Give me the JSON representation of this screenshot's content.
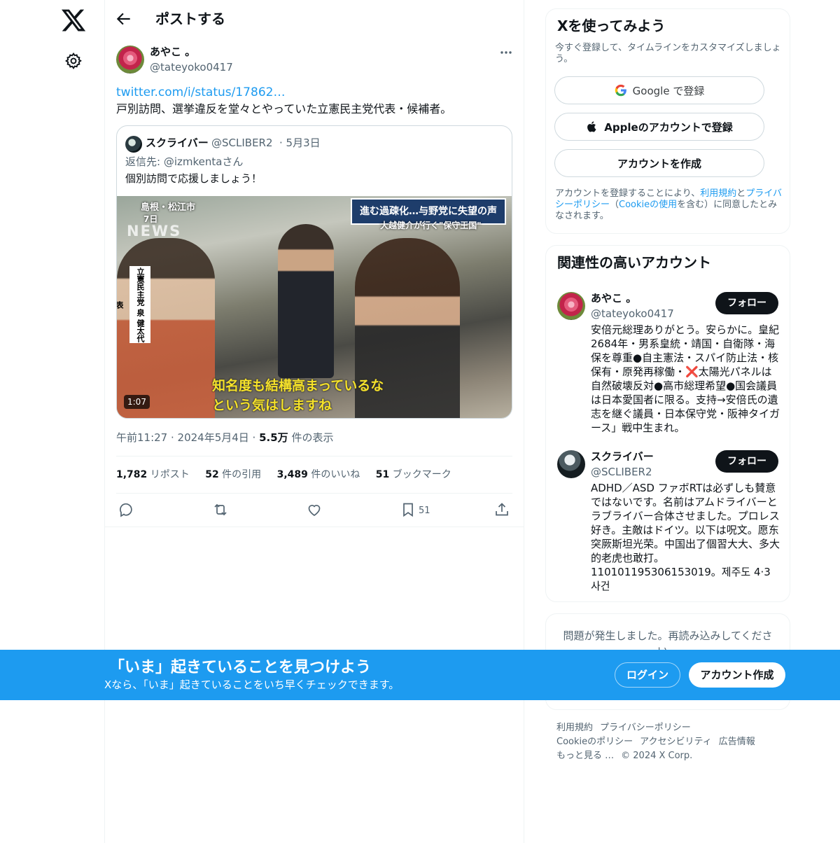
{
  "nav": {
    "logo_icon": "x-logo-icon",
    "settings_icon": "gear-icon"
  },
  "header": {
    "title": "ポストする"
  },
  "post": {
    "author_name": "あやこ 。",
    "author_handle": "@tateyoko0417",
    "link": "twitter.com/i/status/17862…",
    "text": "戸別訪問、選挙違反を堂々とやっていた立憲民主党代表・候補者。",
    "quote": {
      "name": "スクライバー",
      "handle": "@SCLIBER2",
      "date": "· 5月3日",
      "reply_to": "返信先: @izmkentaさん",
      "text": "個別訪問で応援しましょう！",
      "video": {
        "banner": "進む過疎化…与野党に失望の声",
        "banner_sub": "大越健介が行く\"保守王国\"",
        "location": "島根・松江市",
        "day": "7日",
        "news_mark": "NEWS",
        "nameplate": "立憲民主党 泉 健太代表",
        "caption_line1": "知名度も結構高まっているな",
        "caption_line2": "という気はしますね",
        "duration": "1:07"
      }
    },
    "time": "午前11:27 · 2024年5月4日 · ",
    "views_count": "5.5万",
    "views_label": " 件の表示",
    "stats": {
      "reposts_count": "1,782",
      "reposts_label": " リポスト",
      "quotes_count": "52",
      "quotes_label": " 件の引用",
      "likes_count": "3,489",
      "likes_label": " 件のいいね",
      "bookmarks_count": "51",
      "bookmarks_label": " ブックマーク"
    },
    "bookmark_action_count": "51"
  },
  "signup": {
    "title": "Xを使ってみよう",
    "subtitle": "今すぐ登録して、タイムラインをカスタマイズしましょう。",
    "google_label": "Google で登録",
    "apple_label": "Appleのアカウントで登録",
    "create_label": "アカウントを作成",
    "legal_prefix": "アカウントを登録することにより、",
    "legal_terms": "利用規約",
    "legal_and": "と",
    "legal_privacy": "プライバシーポリシー",
    "legal_paren_open": "（",
    "legal_cookie": "Cookieの使用",
    "legal_suffix": "を含む）に同意したとみなされます。"
  },
  "related": {
    "title": "関連性の高いアカウント",
    "accounts": [
      {
        "name": "あやこ 。",
        "handle": "@tateyoko0417",
        "follow_label": "フォロー",
        "bio": "安倍元総理ありがとう。安らかに。皇紀2684年・男系皇統・靖国・自衛隊・海保を尊重●自主憲法・スパイ防止法・核保有・原発再稼働・❌太陽光パネルは自然破壊反対●高市総理希望●国会議員は日本愛国者に限る。支持→安倍氏の遺志を継ぐ議員・日本保守党・阪神タイガース」戦中生まれ。"
      },
      {
        "name": "スクライバー",
        "handle": "@SCLIBER2",
        "follow_label": "フォロー",
        "bio": "ADHD／ASD ファボRTは必ずしも賛意ではないです。名前はアムドライバーとラブライバー合体させました。プロレス好き。主敵はドイツ。以下は呪文。愿东突厥斯坦光荣。中国出了個習大大、多大的老虎也敢打。110101195306153019。제주도 4·3 사건"
      }
    ]
  },
  "error": {
    "text": "問題が発生しました。再読み込みしてください。"
  },
  "footer": {
    "terms": "利用規約",
    "privacy": "プライバシーポリシー",
    "cookie": "Cookieのポリシー",
    "accessibility": "アクセシビリティ",
    "ads": "広告情報",
    "more": "もっと見る …",
    "copyright": "© 2024 X Corp."
  },
  "banner": {
    "title": "「いま」起きていることを見つけよう",
    "subtitle": "Xなら、「いま」起きていることをいち早くチェックできます。",
    "login_label": "ログイン",
    "create_label": "アカウント作成"
  },
  "colors": {
    "accent": "#1d9bf0",
    "text": "#0f1419",
    "muted": "#536471"
  }
}
